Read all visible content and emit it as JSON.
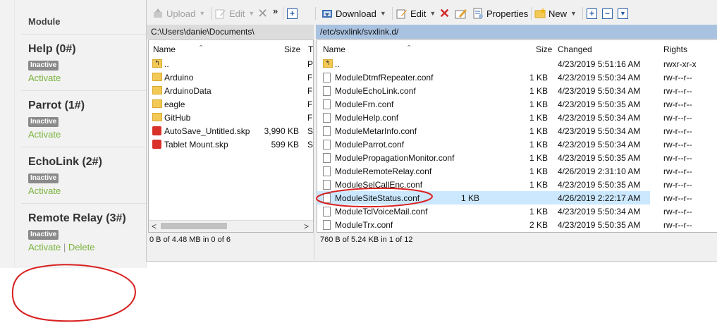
{
  "web_panel": {
    "header": "Module",
    "modules": [
      {
        "name": "Help (0#)",
        "status": "Inactive",
        "activate": "Activate",
        "delete": ""
      },
      {
        "name": "Parrot (1#)",
        "status": "Inactive",
        "activate": "Activate",
        "delete": ""
      },
      {
        "name": "EchoLink (2#)",
        "status": "Inactive",
        "activate": "Activate",
        "delete": ""
      },
      {
        "name": "Remote Relay (3#)",
        "status": "Inactive",
        "activate": "Activate",
        "delete": "Delete",
        "separator": "|"
      }
    ]
  },
  "left_pane": {
    "toolbar": {
      "upload": "Upload",
      "edit": "Edit",
      "more": "»"
    },
    "path": "C:\\Users\\danie\\Documents\\",
    "columns": {
      "name": "Name",
      "size": "Size",
      "type": "T"
    },
    "rows": [
      {
        "name": "..",
        "size": "",
        "type": "P",
        "kind": "up"
      },
      {
        "name": "Arduino",
        "size": "",
        "type": "F",
        "kind": "folder"
      },
      {
        "name": "ArduinoData",
        "size": "",
        "type": "F",
        "kind": "folder"
      },
      {
        "name": "eagle",
        "size": "",
        "type": "F",
        "kind": "folder"
      },
      {
        "name": "GitHub",
        "size": "",
        "type": "F",
        "kind": "folder"
      },
      {
        "name": "AutoSave_Untitled.skp",
        "size": "3,990 KB",
        "type": "S",
        "kind": "skp"
      },
      {
        "name": "Tablet Mount.skp",
        "size": "599 KB",
        "type": "S",
        "kind": "skp"
      }
    ],
    "status": "0 B of 4.48 MB in 0 of 6",
    "scroll_left": "<",
    "scroll_right": ">"
  },
  "right_pane": {
    "toolbar": {
      "more": "»",
      "download": "Download",
      "edit": "Edit",
      "properties": "Properties",
      "new": "New"
    },
    "path": "/etc/svxlink/svxlink.d/",
    "columns": {
      "name": "Name",
      "size": "Size",
      "changed": "Changed",
      "rights": "Rights"
    },
    "rows": [
      {
        "name": "..",
        "size": "",
        "changed": "4/23/2019 5:51:16 AM",
        "rights": "rwxr-xr-x",
        "kind": "up"
      },
      {
        "name": "ModuleDtmfRepeater.conf",
        "size": "1 KB",
        "changed": "4/23/2019 5:50:34 AM",
        "rights": "rw-r--r--",
        "kind": "file"
      },
      {
        "name": "ModuleEchoLink.conf",
        "size": "1 KB",
        "changed": "4/23/2019 5:50:34 AM",
        "rights": "rw-r--r--",
        "kind": "file"
      },
      {
        "name": "ModuleFrn.conf",
        "size": "1 KB",
        "changed": "4/23/2019 5:50:35 AM",
        "rights": "rw-r--r--",
        "kind": "file"
      },
      {
        "name": "ModuleHelp.conf",
        "size": "1 KB",
        "changed": "4/23/2019 5:50:34 AM",
        "rights": "rw-r--r--",
        "kind": "file"
      },
      {
        "name": "ModuleMetarInfo.conf",
        "size": "1 KB",
        "changed": "4/23/2019 5:50:34 AM",
        "rights": "rw-r--r--",
        "kind": "file"
      },
      {
        "name": "ModuleParrot.conf",
        "size": "1 KB",
        "changed": "4/23/2019 5:50:34 AM",
        "rights": "rw-r--r--",
        "kind": "file"
      },
      {
        "name": "ModulePropagationMonitor.conf",
        "size": "1 KB",
        "changed": "4/23/2019 5:50:35 AM",
        "rights": "rw-r--r--",
        "kind": "file"
      },
      {
        "name": "ModuleRemoteRelay.conf",
        "size": "1 KB",
        "changed": "4/26/2019 2:31:10 AM",
        "rights": "rw-r--r--",
        "kind": "file"
      },
      {
        "name": "ModuleSelCallEnc.conf",
        "size": "1 KB",
        "changed": "4/23/2019 5:50:35 AM",
        "rights": "rw-r--r--",
        "kind": "file"
      },
      {
        "name": "ModuleSiteStatus.conf",
        "size": "1 KB",
        "changed": "4/26/2019 2:22:17 AM",
        "rights": "rw-r--r--",
        "kind": "file",
        "selected": true
      },
      {
        "name": "ModuleTclVoiceMail.conf",
        "size": "1 KB",
        "changed": "4/23/2019 5:50:34 AM",
        "rights": "rw-r--r--",
        "kind": "file"
      },
      {
        "name": "ModuleTrx.conf",
        "size": "2 KB",
        "changed": "4/23/2019 5:50:35 AM",
        "rights": "rw-r--r--",
        "kind": "file"
      }
    ],
    "status": "760 B of 5.24 KB in 1 of 12"
  },
  "colors": {
    "annotation": "#d92020",
    "selection": "#cce8ff",
    "path_active": "#a9c2e0",
    "link": "#7ab33e"
  }
}
